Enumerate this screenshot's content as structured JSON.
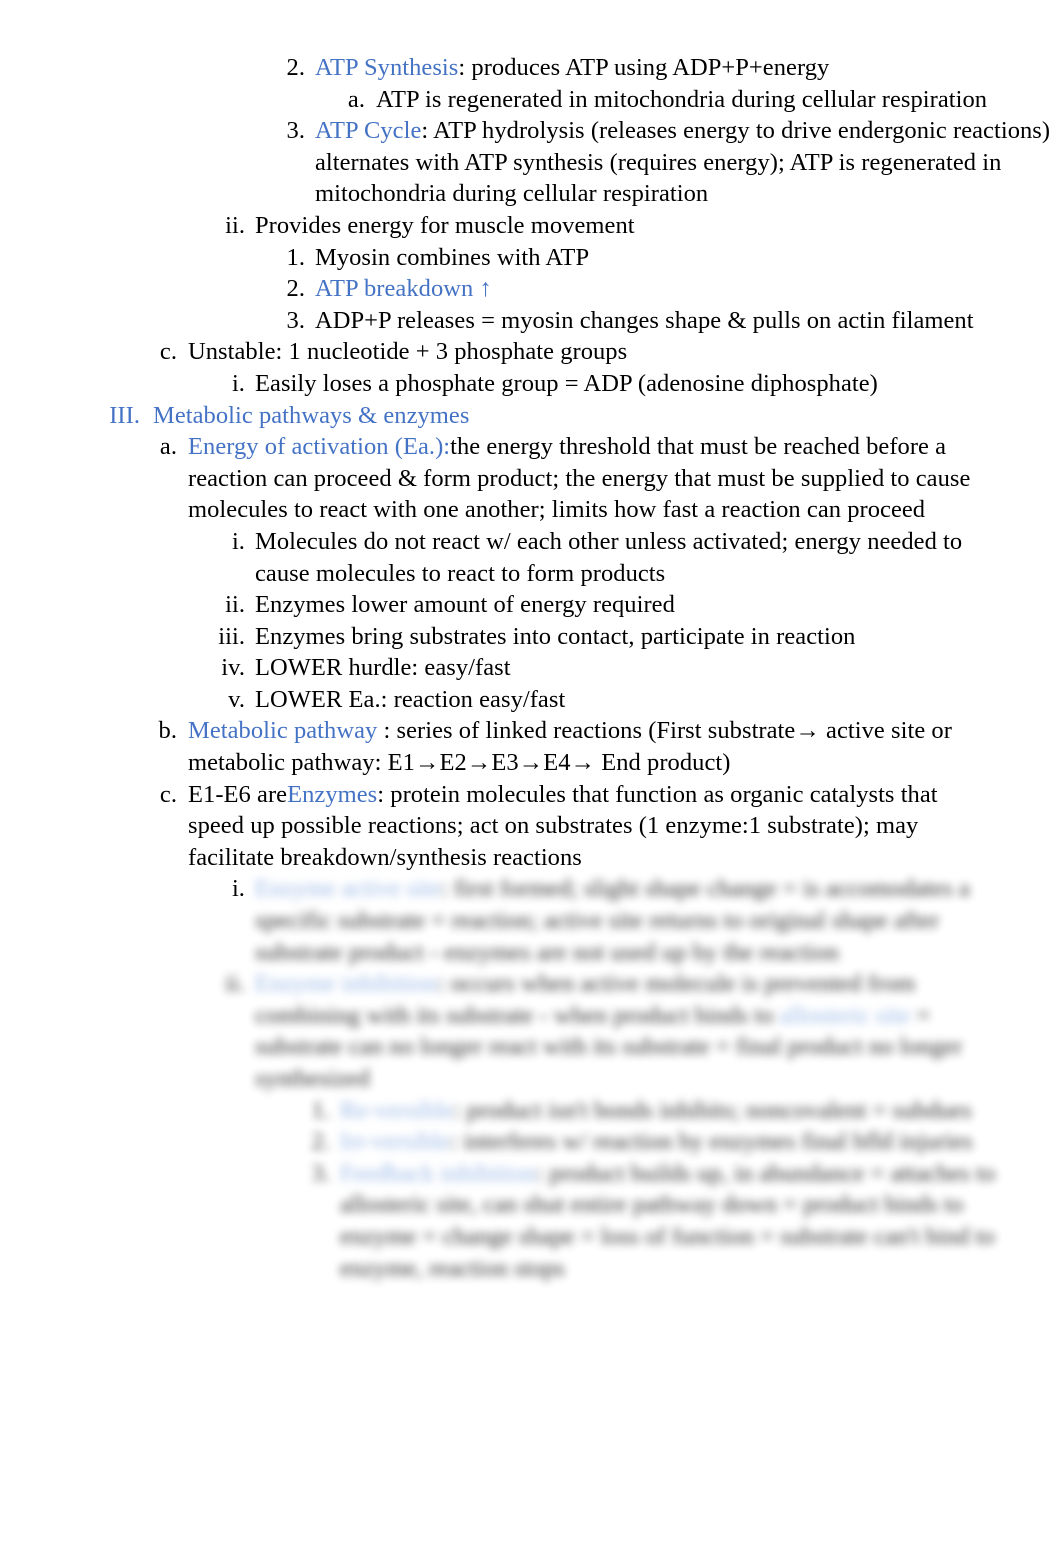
{
  "document": {
    "type": "outline-notes",
    "page_background": "#ffffff",
    "text_color": "#000000",
    "accent_color": "#4472C4",
    "blur_note": "lower portion of the page is blurred / illegible"
  },
  "outline": [
    {
      "id": "atp-synthesis",
      "marker": "2.",
      "level": "num",
      "term": "ATP Synthesis",
      "term_color": "#4472C4",
      "text": ": produces ATP using ADP+P+energy"
    },
    {
      "id": "atp-regenerated",
      "marker": "a.",
      "level": "alpha2",
      "term": "",
      "text": "ATP is regenerated in mitochondria during cellular respiration"
    },
    {
      "id": "atp-cycle",
      "marker": "3.",
      "level": "num",
      "term": "ATP Cycle",
      "term_color": "#4472C4",
      "text": ": ATP hydrolysis (releases energy to drive endergonic reactions) alternates with ATP synthesis (requires energy); ATP is regenerated in mitochondria during cellular respiration"
    },
    {
      "id": "provides-energy",
      "marker": "ii.",
      "level": "lower",
      "term": "",
      "text": "Provides energy for muscle movement"
    },
    {
      "id": "myosin-combines",
      "marker": "1.",
      "level": "num",
      "term": "",
      "text": "Myosin combines with ATP"
    },
    {
      "id": "atp-breakdown",
      "marker": "2.",
      "level": "num",
      "term": "ATP breakdown ↑",
      "term_color": "#4472C4",
      "text": ""
    },
    {
      "id": "adp-releases",
      "marker": "3.",
      "level": "num",
      "term": "",
      "text": "ADP+P releases = myosin changes shape & pulls on actin filament"
    },
    {
      "id": "unstable",
      "marker": "c.",
      "level": "alpha",
      "term": "",
      "text": "Unstable: 1 nucleotide + 3 phosphate groups"
    },
    {
      "id": "easily-loses",
      "marker": "i.",
      "level": "lower",
      "term": "",
      "text": "Easily loses a phosphate group = ADP (adenosine diphosphate)"
    },
    {
      "id": "metabolic-pathways-heading",
      "marker": "III.",
      "level": "roman",
      "term": "Metabolic pathways & enzymes",
      "term_color": "#4472C4",
      "text": "",
      "heading": true
    },
    {
      "id": "energy-of-activation",
      "marker": "a.",
      "level": "alpha",
      "term": "Energy of activation (Ea.):",
      "term_color": "#4472C4",
      "text": "the energy threshold that must be reached before a reaction can proceed & form product; the energy that must be supplied to cause molecules to react with one another; limits how fast a reaction can proceed"
    },
    {
      "id": "molecules-do-not-react",
      "marker": "i.",
      "level": "lower",
      "term": "",
      "text": "Molecules do not react w/ each other unless activated; energy needed to cause molecules to react to form products"
    },
    {
      "id": "enzymes-lower-energy",
      "marker": "ii.",
      "level": "lower",
      "term": "",
      "text": "Enzymes lower amount of energy required"
    },
    {
      "id": "enzymes-bring-substrates",
      "marker": "iii.",
      "level": "lower",
      "term": "",
      "text": "Enzymes bring substrates into contact, participate in reaction"
    },
    {
      "id": "lower-hurdle",
      "marker": "iv.",
      "level": "lower",
      "term": "",
      "text": "LOWER hurdle: easy/fast"
    },
    {
      "id": "lower-ea",
      "marker": "v.",
      "level": "lower",
      "term": "",
      "text": "LOWER Ea.: reaction easy/fast"
    },
    {
      "id": "metabolic-pathway",
      "marker": "b.",
      "level": "alpha",
      "term": "Metabolic pathway",
      "term_color": "#4472C4",
      "text": " : series of linked reactions (First substrate→ active site or metabolic pathway: E1→E2→E3→E4→ End product)"
    },
    {
      "id": "enzymes-definition",
      "marker": "c.",
      "level": "alpha",
      "prefix": "E1-E6 are",
      "term": "Enzymes",
      "term_color": "#4472C4",
      "text": ": protein molecules that function as organic catalysts that speed up possible reactions; act on substrates (1 enzyme:1 substrate); may facilitate breakdown/synthesis reactions"
    }
  ],
  "blurred_section": [
    {
      "id": "enzyme-active-site",
      "marker": "i.",
      "level": "lower",
      "term": "Enzyme active site",
      "term_color": "#4472C4",
      "text": ": first formed; slight shape change = is accomodates a specific substrate = reaction; active site returns to original shape after substrate product - enzymes are not used up by the reaction"
    },
    {
      "id": "enzyme-inhibition",
      "marker": "ii.",
      "level": "lower",
      "term": "Enzyme inhibition",
      "term_color": "#4472C4",
      "text": ": occurs when active molecule is prevented from combining with its substrate - when product binds to ",
      "term2": "allosteric site",
      "term2_color": "#4472C4",
      "text2": " = substrate can no longer react with its substrate = final product no longer synthesized"
    },
    {
      "id": "reversible",
      "marker": "1.",
      "level": "deep",
      "term": "Re-versible",
      "term_color": "#4472C4",
      "text": ": product isn't bonds inhibits; noncovalent = subdues"
    },
    {
      "id": "irreversible",
      "marker": "2.",
      "level": "deep",
      "term": "Irr-versible",
      "term_color": "#4472C4",
      "text": ": interferes w/ reaction by enzymes final bfld injuries"
    },
    {
      "id": "feedback-inhibition",
      "marker": "3.",
      "level": "deep",
      "term": "Feedback inhibition",
      "term_color": "#4472C4",
      "text": ": product builds up, in abundance = attaches to allosteric site, can shut entire pathway down = product binds to enzyme = change shape = loss of function = substrate can't bind to enzyme, reaction stops"
    }
  ]
}
